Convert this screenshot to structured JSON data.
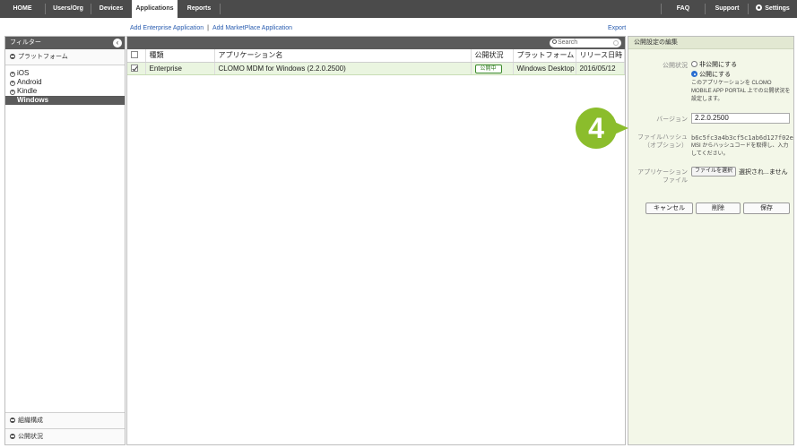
{
  "nav": {
    "items": [
      "HOME",
      "Users/Org",
      "Devices",
      "Applications",
      "Reports"
    ],
    "right_items": [
      "FAQ",
      "Support",
      "Settings"
    ]
  },
  "links": {
    "add_enterprise": "Add Enterprise Application",
    "add_marketplace": "Add MarketPlace Application",
    "separator": "|",
    "export": "Export"
  },
  "sidebar": {
    "header": "フィルター",
    "collapse_glyph": "‹",
    "platform_section": "プラットフォーム",
    "platforms": [
      "iOS",
      "Android",
      "Kindle",
      "Windows"
    ],
    "bottom_sections": [
      "組織構成",
      "公開状況"
    ]
  },
  "search": {
    "placeholder": "Search"
  },
  "table": {
    "headers": [
      "種類",
      "アプリケーション名",
      "公開状況",
      "プラットフォーム",
      "リリース日時"
    ],
    "rows": [
      {
        "type": "Enterprise",
        "name": "CLOMO MDM for Windows (2.2.0.2500)",
        "status": "公開中",
        "platform": "Windows Desktop",
        "date": "2016/05/12"
      }
    ]
  },
  "panel": {
    "title": "公開設定の編集",
    "status_label": "公開状況",
    "option_private": "非公開にする",
    "option_public": "公開にする",
    "status_help": "このアプリケーションを CLOMO MOBILE APP PORTAL 上での公開状況を設定します。",
    "version_label": "バージョン",
    "version_value": "2.2.0.2500",
    "hash_label_1": "ファイルハッシュ",
    "hash_label_2": "（オプション）",
    "hash_value": "b6c5fc3a4b3cf5c1ab6d127f02e",
    "hash_help": "MSI からハッシュコードを取得し、入力してください。",
    "file_label_1": "アプリケーション",
    "file_label_2": "ファイル",
    "file_button": "ファイルを選択",
    "file_status": "選択され...ません",
    "cancel_button": "キャンセル",
    "delete_button": "削除",
    "save_button": "保存"
  },
  "step_number": "4",
  "colors": {
    "accent": "#8bbd2c",
    "nav_bg": "#4b4b4b",
    "selected_row": "#eaf5e0"
  }
}
